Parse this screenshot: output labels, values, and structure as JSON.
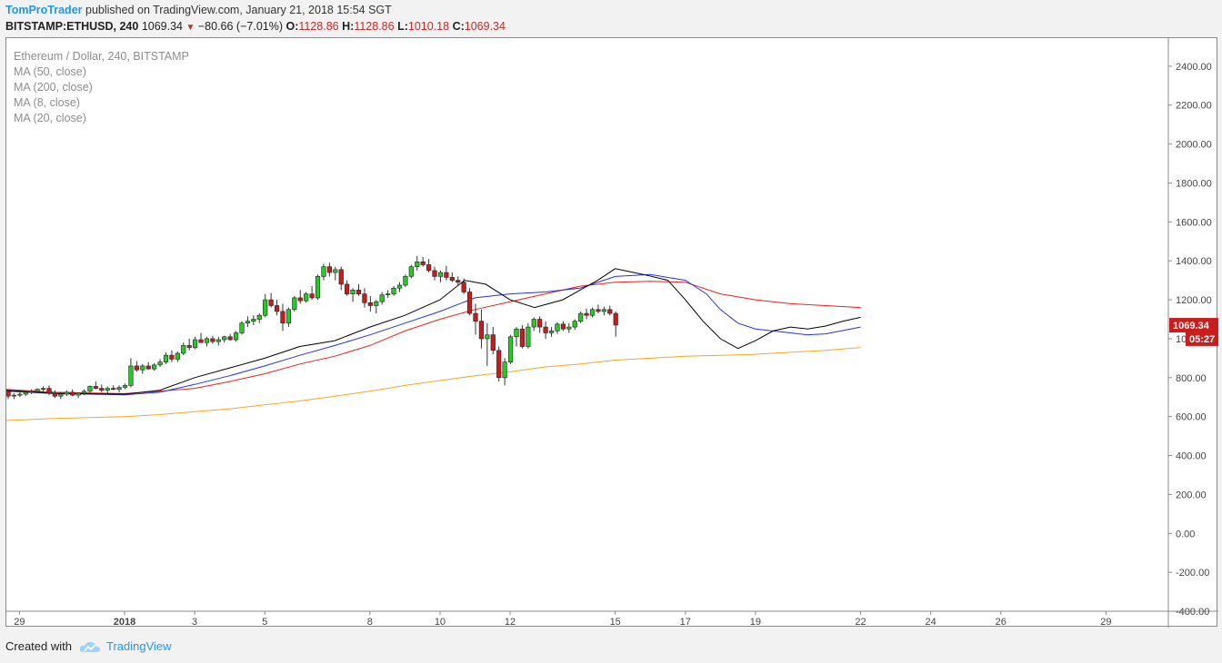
{
  "header": {
    "author": "TomProTrader",
    "published_text": "published on TradingView.com, January 21, 2018 15:54 SGT",
    "symbol": "BITSTAMP:ETHUSD, 240",
    "last": "1069.34",
    "change": "−80.66 (−7.01%)",
    "o_label": "O:",
    "o_value": "1128.86",
    "h_label": "H:",
    "h_value": "1128.86",
    "l_label": "L:",
    "l_value": "1010.18",
    "c_label": "C:",
    "c_value": "1069.34"
  },
  "legend": {
    "title": "Ethereum / Dollar, 240, BITSTAMP",
    "indicators": [
      "MA (50, close)",
      "MA (200, close)",
      "MA (8, close)",
      "MA (20, close)"
    ]
  },
  "footer": {
    "created_with": "Created with",
    "brand": "TradingView"
  },
  "colors": {
    "up": "#26c926",
    "down": "#c61c1c",
    "wick": "#333333",
    "ma8": "#000000",
    "ma20": "#2233dd",
    "ma50": "#e8221a",
    "ma200": "#f5a623",
    "price_tag": "#c81e1e",
    "author": "#2196f3"
  },
  "chart_data": {
    "type": "candlestick",
    "ylim": [
      -400,
      2600
    ],
    "yticks": [
      "2400.00",
      "2200.00",
      "2000.00",
      "1800.00",
      "1600.00",
      "1400.00",
      "1200.00",
      "1000.00",
      "800.00",
      "600.00",
      "400.00",
      "200.00",
      "0.00",
      "-200.00",
      "-400.00"
    ],
    "ytick_values": [
      2400,
      2200,
      2000,
      1800,
      1600,
      1400,
      1200,
      1000,
      800,
      600,
      400,
      200,
      0,
      -200,
      -400
    ],
    "xticks": [
      {
        "label": "29",
        "day": -3
      },
      {
        "label": "2018",
        "day": 0
      },
      {
        "label": "3",
        "day": 2
      },
      {
        "label": "5",
        "day": 4
      },
      {
        "label": "8",
        "day": 7
      },
      {
        "label": "10",
        "day": 9
      },
      {
        "label": "12",
        "day": 11
      },
      {
        "label": "15",
        "day": 14
      },
      {
        "label": "17",
        "day": 16
      },
      {
        "label": "19",
        "day": 18
      },
      {
        "label": "22",
        "day": 21
      },
      {
        "label": "24",
        "day": 23
      },
      {
        "label": "26",
        "day": 25
      },
      {
        "label": "29",
        "day": 28
      }
    ],
    "last_price_tag": "1069.34",
    "countdown_tag": "05:27",
    "countdown_value": 1000,
    "candles": [
      [
        730,
        735,
        690,
        705
      ],
      [
        705,
        720,
        690,
        710
      ],
      [
        710,
        725,
        700,
        715
      ],
      [
        715,
        730,
        705,
        725
      ],
      [
        725,
        740,
        715,
        730
      ],
      [
        730,
        745,
        720,
        740
      ],
      [
        740,
        755,
        730,
        745
      ],
      [
        745,
        760,
        710,
        720
      ],
      [
        720,
        735,
        695,
        705
      ],
      [
        705,
        725,
        690,
        715
      ],
      [
        715,
        735,
        705,
        725
      ],
      [
        725,
        740,
        705,
        710
      ],
      [
        710,
        725,
        695,
        720
      ],
      [
        720,
        740,
        710,
        730
      ],
      [
        730,
        760,
        720,
        755
      ],
      [
        755,
        780,
        740,
        745
      ],
      [
        745,
        765,
        725,
        735
      ],
      [
        735,
        755,
        720,
        745
      ],
      [
        745,
        760,
        735,
        740
      ],
      [
        740,
        760,
        725,
        750
      ],
      [
        750,
        770,
        740,
        760
      ],
      [
        760,
        900,
        750,
        860
      ],
      [
        860,
        885,
        830,
        840
      ],
      [
        840,
        870,
        820,
        860
      ],
      [
        860,
        880,
        840,
        845
      ],
      [
        845,
        875,
        835,
        865
      ],
      [
        865,
        895,
        855,
        880
      ],
      [
        880,
        930,
        870,
        915
      ],
      [
        915,
        940,
        880,
        895
      ],
      [
        895,
        935,
        880,
        925
      ],
      [
        925,
        980,
        915,
        965
      ],
      [
        965,
        1000,
        940,
        955
      ],
      [
        955,
        1010,
        945,
        995
      ],
      [
        995,
        1030,
        980,
        980
      ],
      [
        980,
        1010,
        960,
        1000
      ],
      [
        1000,
        1015,
        975,
        985
      ],
      [
        985,
        1010,
        965,
        995
      ],
      [
        995,
        1015,
        980,
        1010
      ],
      [
        1010,
        1025,
        990,
        995
      ],
      [
        995,
        1040,
        985,
        1030
      ],
      [
        1030,
        1090,
        1020,
        1080
      ],
      [
        1080,
        1115,
        1060,
        1090
      ],
      [
        1090,
        1120,
        1070,
        1100
      ],
      [
        1100,
        1130,
        1080,
        1120
      ],
      [
        1120,
        1230,
        1110,
        1200
      ],
      [
        1200,
        1235,
        1160,
        1170
      ],
      [
        1170,
        1200,
        1120,
        1140
      ],
      [
        1140,
        1180,
        1040,
        1080
      ],
      [
        1080,
        1160,
        1060,
        1150
      ],
      [
        1150,
        1220,
        1140,
        1210
      ],
      [
        1210,
        1250,
        1180,
        1195
      ],
      [
        1195,
        1240,
        1185,
        1230
      ],
      [
        1230,
        1270,
        1200,
        1210
      ],
      [
        1210,
        1330,
        1200,
        1320
      ],
      [
        1320,
        1385,
        1300,
        1370
      ],
      [
        1370,
        1390,
        1320,
        1340
      ],
      [
        1340,
        1370,
        1300,
        1355
      ],
      [
        1355,
        1370,
        1250,
        1280
      ],
      [
        1280,
        1300,
        1220,
        1230
      ],
      [
        1230,
        1260,
        1190,
        1250
      ],
      [
        1250,
        1280,
        1220,
        1230
      ],
      [
        1230,
        1260,
        1160,
        1185
      ],
      [
        1185,
        1220,
        1140,
        1170
      ],
      [
        1170,
        1200,
        1130,
        1190
      ],
      [
        1190,
        1240,
        1175,
        1225
      ],
      [
        1225,
        1250,
        1210,
        1230
      ],
      [
        1230,
        1270,
        1220,
        1260
      ],
      [
        1260,
        1290,
        1240,
        1275
      ],
      [
        1275,
        1330,
        1265,
        1320
      ],
      [
        1320,
        1380,
        1310,
        1370
      ],
      [
        1370,
        1425,
        1350,
        1395
      ],
      [
        1395,
        1420,
        1370,
        1380
      ],
      [
        1380,
        1410,
        1340,
        1350
      ],
      [
        1350,
        1370,
        1300,
        1320
      ],
      [
        1320,
        1350,
        1290,
        1340
      ],
      [
        1340,
        1375,
        1300,
        1315
      ],
      [
        1315,
        1340,
        1290,
        1300
      ],
      [
        1300,
        1320,
        1270,
        1290
      ],
      [
        1290,
        1310,
        1230,
        1240
      ],
      [
        1240,
        1260,
        1120,
        1130
      ],
      [
        1130,
        1180,
        1020,
        1090
      ],
      [
        1090,
        1150,
        950,
        1000
      ],
      [
        1000,
        1080,
        860,
        1020
      ],
      [
        1020,
        1060,
        920,
        940
      ],
      [
        940,
        960,
        780,
        800
      ],
      [
        800,
        900,
        760,
        880
      ],
      [
        880,
        1020,
        870,
        1010
      ],
      [
        1010,
        1060,
        960,
        1050
      ],
      [
        1050,
        1070,
        950,
        960
      ],
      [
        960,
        1080,
        950,
        1060
      ],
      [
        1060,
        1110,
        1040,
        1100
      ],
      [
        1100,
        1115,
        1030,
        1060
      ],
      [
        1060,
        1090,
        1000,
        1030
      ],
      [
        1030,
        1060,
        1010,
        1040
      ],
      [
        1040,
        1085,
        1025,
        1075
      ],
      [
        1075,
        1090,
        1040,
        1050
      ],
      [
        1050,
        1080,
        1030,
        1060
      ],
      [
        1060,
        1100,
        1045,
        1090
      ],
      [
        1090,
        1140,
        1080,
        1130
      ],
      [
        1130,
        1155,
        1100,
        1120
      ],
      [
        1120,
        1160,
        1110,
        1150
      ],
      [
        1150,
        1175,
        1130,
        1140
      ],
      [
        1140,
        1165,
        1120,
        1150
      ],
      [
        1150,
        1170,
        1120,
        1130
      ],
      [
        1130,
        1140,
        1010,
        1070
      ]
    ],
    "ma8": [
      [
        -4,
        735
      ],
      [
        -2,
        720
      ],
      [
        0,
        715
      ],
      [
        1,
        735
      ],
      [
        2,
        800
      ],
      [
        3,
        850
      ],
      [
        4,
        900
      ],
      [
        5,
        960
      ],
      [
        6,
        990
      ],
      [
        7,
        1060
      ],
      [
        8,
        1120
      ],
      [
        9,
        1200
      ],
      [
        9.7,
        1300
      ],
      [
        10.3,
        1280
      ],
      [
        11,
        1200
      ],
      [
        11.7,
        1160
      ],
      [
        12.5,
        1200
      ],
      [
        13.5,
        1300
      ],
      [
        14,
        1360
      ],
      [
        14.8,
        1330
      ],
      [
        15.5,
        1300
      ],
      [
        16,
        1200
      ],
      [
        16.5,
        1090
      ],
      [
        17,
        1000
      ],
      [
        17.5,
        950
      ],
      [
        18,
        990
      ],
      [
        18.5,
        1040
      ],
      [
        19,
        1060
      ],
      [
        19.5,
        1050
      ],
      [
        20,
        1065
      ],
      [
        20.5,
        1090
      ],
      [
        21,
        1110
      ]
    ],
    "ma20": [
      [
        -4,
        730
      ],
      [
        -2,
        718
      ],
      [
        0,
        712
      ],
      [
        1,
        725
      ],
      [
        2,
        765
      ],
      [
        3,
        810
      ],
      [
        4,
        860
      ],
      [
        5,
        915
      ],
      [
        6,
        965
      ],
      [
        7,
        1020
      ],
      [
        8,
        1080
      ],
      [
        9,
        1140
      ],
      [
        10,
        1210
      ],
      [
        11,
        1230
      ],
      [
        12,
        1240
      ],
      [
        13,
        1260
      ],
      [
        14,
        1320
      ],
      [
        15,
        1330
      ],
      [
        16,
        1300
      ],
      [
        16.6,
        1230
      ],
      [
        17,
        1150
      ],
      [
        17.5,
        1080
      ],
      [
        18,
        1050
      ],
      [
        18.5,
        1040
      ],
      [
        19,
        1030
      ],
      [
        19.5,
        1020
      ],
      [
        20,
        1025
      ],
      [
        21,
        1060
      ]
    ],
    "ma50": [
      [
        -4,
        740
      ],
      [
        -2,
        725
      ],
      [
        0,
        718
      ],
      [
        1,
        730
      ],
      [
        2,
        745
      ],
      [
        3,
        780
      ],
      [
        4,
        820
      ],
      [
        5,
        870
      ],
      [
        6,
        910
      ],
      [
        7,
        965
      ],
      [
        8,
        1040
      ],
      [
        9,
        1100
      ],
      [
        10,
        1150
      ],
      [
        11,
        1190
      ],
      [
        12,
        1230
      ],
      [
        13,
        1270
      ],
      [
        14,
        1290
      ],
      [
        15,
        1295
      ],
      [
        16,
        1290
      ],
      [
        17,
        1230
      ],
      [
        18,
        1200
      ],
      [
        19,
        1180
      ],
      [
        20,
        1170
      ],
      [
        21,
        1160
      ]
    ],
    "ma200": [
      [
        -4,
        580
      ],
      [
        -2,
        590
      ],
      [
        0,
        600
      ],
      [
        1,
        610
      ],
      [
        2,
        625
      ],
      [
        3,
        640
      ],
      [
        4,
        660
      ],
      [
        5,
        680
      ],
      [
        6,
        705
      ],
      [
        7,
        730
      ],
      [
        8,
        760
      ],
      [
        9,
        785
      ],
      [
        10,
        810
      ],
      [
        11,
        830
      ],
      [
        12,
        855
      ],
      [
        13,
        870
      ],
      [
        14,
        890
      ],
      [
        15,
        900
      ],
      [
        16,
        910
      ],
      [
        17,
        915
      ],
      [
        18,
        920
      ],
      [
        19,
        930
      ],
      [
        20,
        940
      ],
      [
        21,
        955
      ]
    ]
  }
}
